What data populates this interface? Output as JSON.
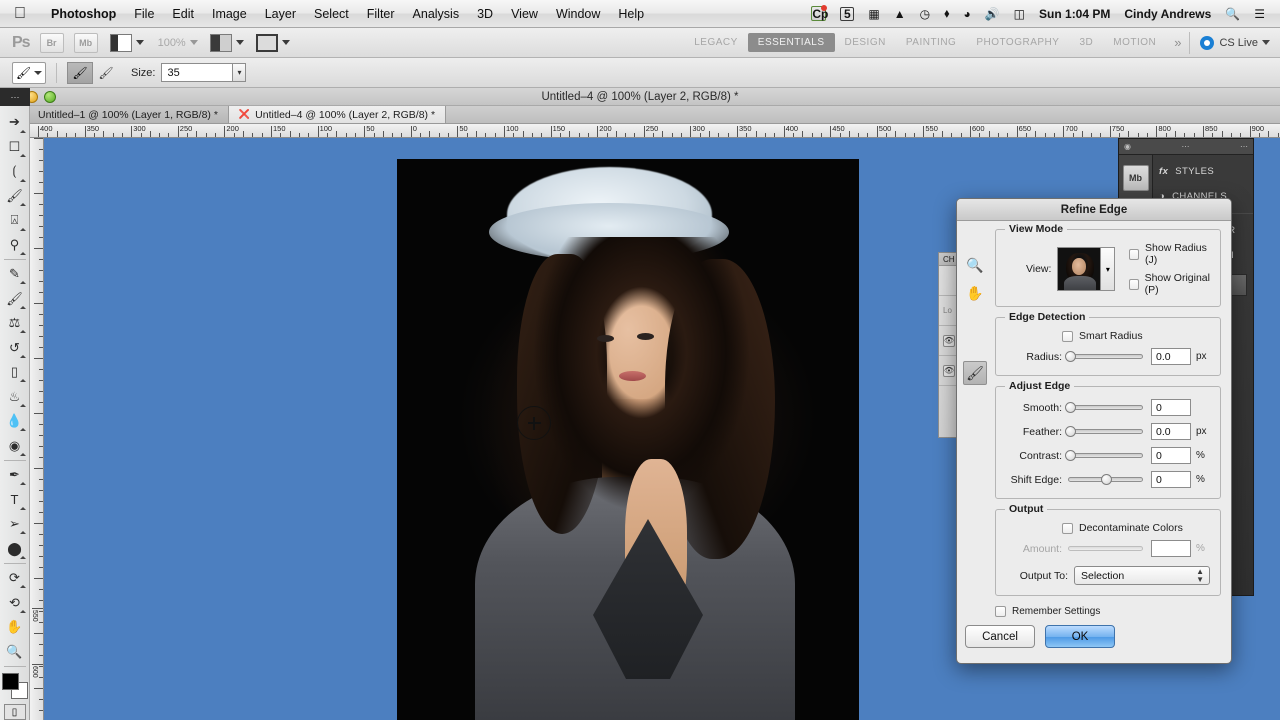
{
  "menubar": {
    "apple_icon": "apple-logo",
    "items": [
      "Photoshop",
      "File",
      "Edit",
      "Image",
      "Layer",
      "Select",
      "Filter",
      "Analysis",
      "3D",
      "View",
      "Window",
      "Help"
    ],
    "status": {
      "icons": [
        "cp-badge-icon",
        "five-badge-icon",
        "dropbox-icon",
        "google-drive-icon",
        "time-machine-icon",
        "bluetooth-icon",
        "wifi-icon",
        "volume-icon",
        "battery-icon"
      ],
      "clock": "Sun 1:04 PM",
      "username": "Cindy Andrews",
      "search_icon": "search-icon",
      "notification_icon": "notification-list-icon"
    }
  },
  "options_bar": {
    "app_logo": "Ps",
    "bridge_label": "Br",
    "mini_bridge_label": "Mb",
    "zoom_level": "100%",
    "workspaces": [
      "LEGACY",
      "ESSENTIALS",
      "DESIGN",
      "PAINTING",
      "PHOTOGRAPHY",
      "3D",
      "MOTION"
    ],
    "active_workspace": "ESSENTIALS",
    "more_label": "»",
    "cs_live_label": "CS Live"
  },
  "tool_options": {
    "tool_icon": "refine-brush-icon",
    "mode_icons": [
      "refine-brush-icon",
      "erase-refinements-icon"
    ],
    "size_label": "Size:",
    "size_value": "35"
  },
  "document": {
    "title": "Untitled–4 @ 100% (Layer 2, RGB/8) *",
    "tabs": [
      {
        "label": "Untitled–1 @ 100% (Layer 1, RGB/8) *",
        "active": false
      },
      {
        "label": "Untitled–4 @ 100% (Layer 2, RGB/8) *",
        "active": true
      }
    ]
  },
  "rulers": {
    "horizontal_labels": [
      "400",
      "350",
      "300",
      "250",
      "200",
      "150",
      "100",
      "50",
      "0",
      "50",
      "100",
      "150",
      "200",
      "250",
      "300",
      "350",
      "400",
      "450",
      "500",
      "550",
      "600",
      "650",
      "700",
      "750",
      "800",
      "850",
      "900"
    ],
    "vertical_labels": [
      "550",
      "600"
    ]
  },
  "toolbar": {
    "tools": [
      "move-tool",
      "rectangular-marquee-tool",
      "lasso-tool",
      "quick-selection-tool",
      "crop-tool",
      "eyedropper-tool",
      "spot-healing-brush-tool",
      "brush-tool",
      "clone-stamp-tool",
      "history-brush-tool",
      "eraser-tool",
      "paint-bucket-tool",
      "blur-tool",
      "dodge-tool",
      "pen-tool",
      "type-tool",
      "path-selection-tool",
      "ellipse-shape-tool",
      "3d-object-rotate-tool",
      "3d-camera-rotate-tool",
      "hand-tool",
      "zoom-tool"
    ],
    "foreground_color": "#000000",
    "background_color": "#ffffff",
    "quick_mask_label": "quick-mask-mode"
  },
  "panels": {
    "right_stack": [
      "STYLES",
      "CHANNELS",
      "CHARACTER",
      "PARAGRAPH"
    ],
    "mini_bridge_label": "Mb",
    "styles_icon": "fx-icon",
    "layers_tab_label": "CH",
    "locked_label": "Lo"
  },
  "dialog": {
    "title": "Refine Edge",
    "tools": [
      "zoom-tool",
      "hand-tool",
      "refine-radius-brush-tool"
    ],
    "view_mode": {
      "legend": "View Mode",
      "view_label": "View:",
      "show_radius_label": "Show Radius (J)",
      "show_radius_checked": false,
      "show_original_label": "Show Original (P)",
      "show_original_checked": false
    },
    "edge_detection": {
      "legend": "Edge Detection",
      "smart_radius_label": "Smart Radius",
      "smart_radius_checked": false,
      "radius_label": "Radius:",
      "radius_value": "0.0",
      "radius_unit": "px",
      "radius_percent": 2
    },
    "adjust_edge": {
      "legend": "Adjust Edge",
      "rows": [
        {
          "label": "Smooth:",
          "value": "0",
          "unit": "",
          "percent": 2
        },
        {
          "label": "Feather:",
          "value": "0.0",
          "unit": "px",
          "percent": 2
        },
        {
          "label": "Contrast:",
          "value": "0",
          "unit": "%",
          "percent": 2
        },
        {
          "label": "Shift Edge:",
          "value": "0",
          "unit": "%",
          "percent": 50
        }
      ]
    },
    "output": {
      "legend": "Output",
      "decontaminate_label": "Decontaminate Colors",
      "decontaminate_checked": false,
      "amount_label": "Amount:",
      "amount_value": "",
      "amount_unit": "%",
      "amount_percent": 2,
      "output_to_label": "Output To:",
      "output_to_value": "Selection"
    },
    "remember_label": "Remember Settings",
    "remember_checked": false,
    "cancel_label": "Cancel",
    "ok_label": "OK",
    "accent_color": "#4e9ae6"
  },
  "colors": {
    "canvas_background": "#4c7fc0",
    "dialog_background": "#ececec",
    "panel_dark": "#3b3b3b",
    "workspace_active": "#8c8c8c"
  }
}
